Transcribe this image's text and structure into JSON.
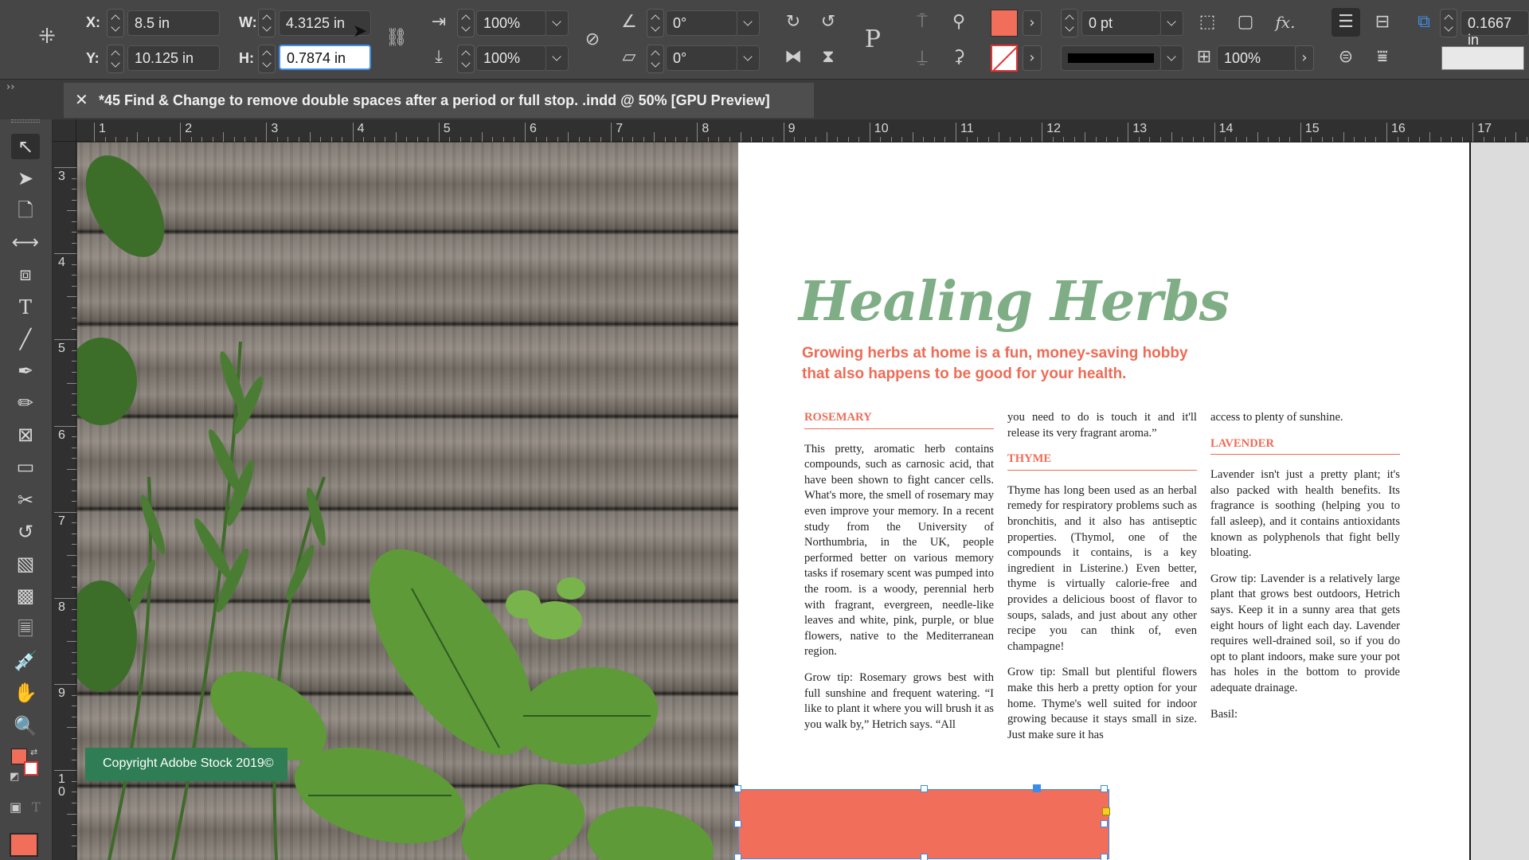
{
  "control_bar": {
    "x_label": "X:",
    "x_value": "8.5 in",
    "y_label": "Y:",
    "y_value": "10.125 in",
    "w_label": "W:",
    "w_value": "4.3125 in",
    "h_label": "H:",
    "h_value": "0.7874 in",
    "scale_x": "100%",
    "scale_y": "100%",
    "rotate": "0°",
    "shear": "0°",
    "fill_color": "#f06e5a",
    "stroke_weight": "0 pt",
    "opacity": "100%",
    "offset": "0.1667 in",
    "fx_label": "fx."
  },
  "document_tab": {
    "title": "*45 Find & Change to remove double spaces after a period or full stop.  .indd @ 50% [GPU Preview]"
  },
  "ruler": {
    "horizontal": [
      "1",
      "2",
      "3",
      "4",
      "5",
      "6",
      "7",
      "8",
      "9",
      "10",
      "11",
      "12",
      "13",
      "14",
      "15",
      "16",
      "17"
    ],
    "vertical": [
      "3",
      "4",
      "5",
      "6",
      "7",
      "8",
      "9",
      "1\n0"
    ]
  },
  "article": {
    "title": "Healing Herbs",
    "subtitle": "Growing herbs at home is a fun, money-saving hobby that also happens to be good for your health.",
    "col1": {
      "heading": "ROSEMARY",
      "p1": "This pretty, aromatic herb contains compounds, such as carnosic acid, that have been shown to fight cancer cells. What's more, the smell of rosemary may even improve your memory. In a recent study from the University of Northumbria, in the UK, people performed better on various memory tasks if rosemary scent was pumped into the room. is a woody, perennial herb with fragrant, evergreen, needle-like leaves and white, pink, purple, or blue flowers, native to the Mediterranean region.",
      "p2": "Grow tip: Rosemary grows best with full sunshine and frequent watering. “I like to plant it where you will brush it as you walk by,” Hetrich says. “All"
    },
    "col2": {
      "p0": "you need to do is touch it and it'll release its very fragrant aroma.”",
      "heading": "THYME",
      "p1": "Thyme has long been used as an herbal remedy for respiratory problems such as bronchitis, and it also has antiseptic properties. (Thymol, one of the compounds it contains, is a key ingredient in Listerine.) Even better, thyme is virtually calorie-free and provides a delicious boost of flavor to soups, salads, and just about any other recipe you can think of, even champagne!",
      "p2": "Grow tip: Small but plentiful flowers make this herb a pretty option for your home. Thyme's well suited for indoor growing because it stays small in size. Just make sure it has"
    },
    "col3": {
      "p0": "access to plenty of sunshine.",
      "heading": "LAVENDER",
      "p1": "Lavender isn't just a pretty plant; it's also packed with health benefits. Its fragrance is soothing (helping you to fall asleep), and it contains antioxidants known as polyphenols that fight belly bloating.",
      "p2": "Grow tip: Lavender is a relatively large plant that grows best outdoors, Hetrich says. Keep it in a sunny area that gets eight hours of light each day. Lavender requires well-drained soil, so if you do opt to plant indoors, make sure your pot has holes in the bottom to provide adequate drainage.",
      "p3": "Basil:"
    }
  },
  "copyright": "Copyright Adobe Stock 2019©",
  "colors": {
    "accent": "#ee6b55",
    "title_green": "#7fae86",
    "selection": "#3b8ee8"
  }
}
